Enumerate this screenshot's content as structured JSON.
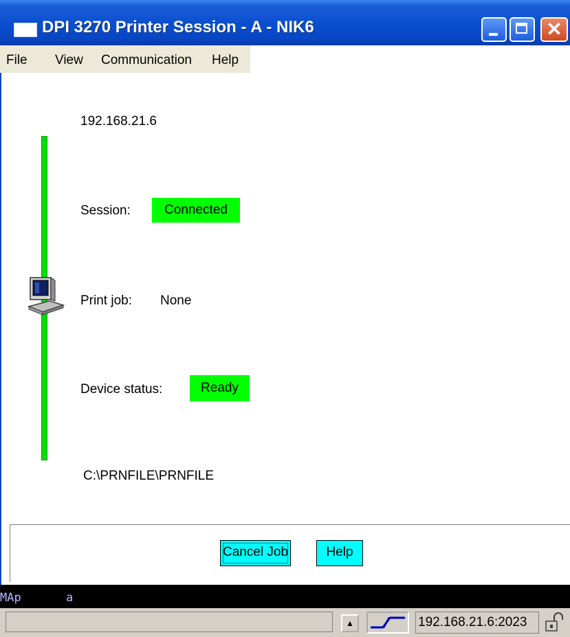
{
  "window": {
    "title": "DPI 3270 Printer Session - A - NIK6",
    "close_glyph": "✕"
  },
  "menu": [
    "File",
    "View",
    "Communication",
    "Help"
  ],
  "host_ip": "192.168.21.6",
  "session": {
    "label": "Session:",
    "value": "Connected",
    "color": "#00ff00"
  },
  "print_job": {
    "label": "Print job:",
    "value": "None"
  },
  "device_status": {
    "label": "Device status:",
    "value": "Ready",
    "color": "#00ff00"
  },
  "output_path": "C:\\PRNFILE\\PRNFILE",
  "buttons": {
    "cancel_job": "Cancel Job",
    "help": "Help"
  },
  "status_line": {
    "left": "MAp",
    "right": "a"
  },
  "bottom": {
    "scroll_glyph": "▲",
    "address": "192.168.21.6:2023",
    "link_icon": "link-bolt-icon",
    "lock_icon": "unlock-icon"
  },
  "colors": {
    "title_blue": "#0a4fd0",
    "status_green": "#00ff00",
    "button_cyan": "#00ffff"
  }
}
